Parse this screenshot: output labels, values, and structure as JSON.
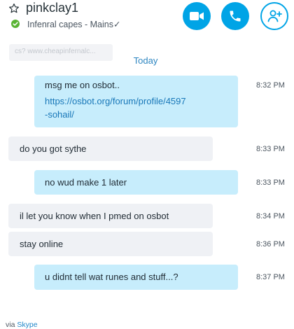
{
  "header": {
    "contact_name": "pinkclay1",
    "status_text": "Infenral capes - Mains✓",
    "actions": [
      "video-call",
      "audio-call",
      "add-people"
    ]
  },
  "banner": {
    "text": "cs? www.cheapinfernalc..."
  },
  "date_separator": "Today",
  "messages": [
    {
      "direction": "outgoing",
      "text": "msg me on osbot..",
      "link_line1": "https://osbot.org/forum/profile/4597",
      "link_line2": "-sohail/",
      "time": "8:32 PM"
    },
    {
      "direction": "incoming",
      "text": "do you got sythe",
      "time": "8:33 PM"
    },
    {
      "direction": "outgoing",
      "text": "no wud make 1 later",
      "time": "8:33 PM"
    },
    {
      "direction": "incoming",
      "text": "il let you know when I pmed on osbot",
      "time": "8:34 PM"
    },
    {
      "direction": "incoming",
      "text": "stay online",
      "time": "8:36 PM"
    },
    {
      "direction": "outgoing",
      "text": "u didnt tell wat runes and stuff...?",
      "time": "8:37 PM"
    }
  ],
  "footer": {
    "via_label": "via",
    "app_name": "Skype"
  },
  "colors": {
    "accent": "#00a4e6",
    "outgoing_bubble": "#c7edfc",
    "incoming_bubble": "#eff1f5",
    "status_online": "#5ab434"
  }
}
